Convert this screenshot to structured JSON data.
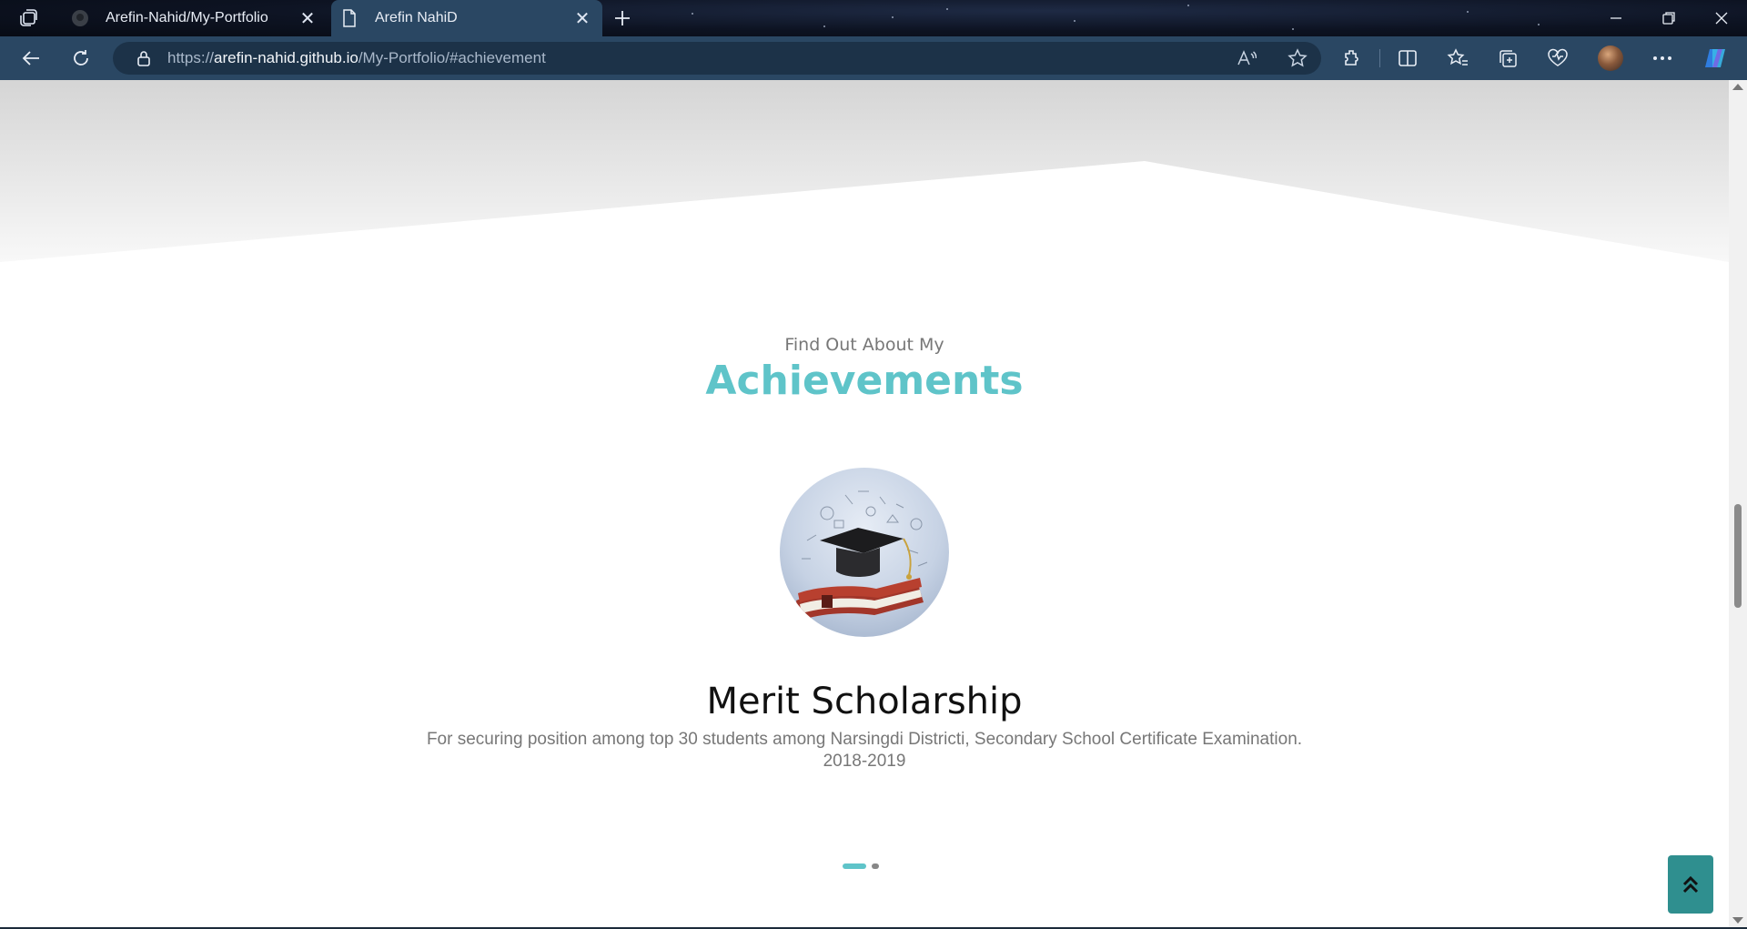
{
  "browser": {
    "tabs": [
      {
        "title": "Arefin-Nahid/My-Portfolio",
        "icon": "github-icon",
        "active": false
      },
      {
        "title": "Arefin NahiD",
        "icon": "page-icon",
        "active": true
      }
    ],
    "url_prefix": "https://",
    "url_host": "arefin-nahid.github.io",
    "url_path": "/My-Portfolio/#achievement"
  },
  "achievements": {
    "subtitle": "Find Out About My",
    "title": "Achievements",
    "item": {
      "title": "Merit Scholarship",
      "description": "For securing position among top 30 students among Narsingdi Districti, Secondary School Certificate Examination.",
      "year": "2018-2019"
    },
    "carousel": {
      "total": 2,
      "active": 1
    }
  },
  "colors": {
    "accent": "#5fc4c9",
    "back_to_top": "#2f8f8f",
    "toolbar": "#2a4763"
  }
}
